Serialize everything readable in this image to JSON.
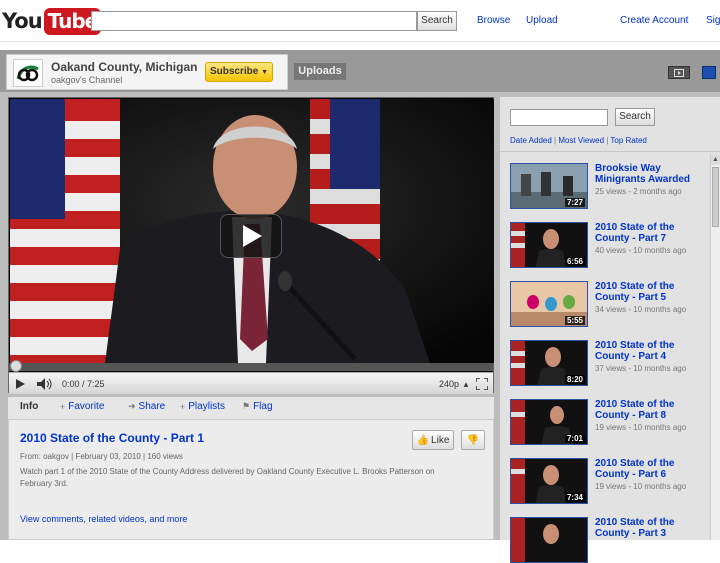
{
  "masthead": {
    "logo_you": "You",
    "logo_tube": "Tube",
    "search_placeholder": "",
    "search_button": "Search",
    "links": [
      "Browse",
      "Upload",
      "Create Account",
      "Sig"
    ]
  },
  "channel": {
    "name": "Oakand County, Michigan",
    "subtitle": "oakgov's Channel",
    "subscribe": "Subscribe",
    "uploads_tab": "Uploads"
  },
  "player": {
    "time": "0:00 / 7:25",
    "quality": "240p",
    "progress": 0.0
  },
  "info_tabs": {
    "info": "Info",
    "favorite": "Favorite",
    "share": "Share",
    "playlists": "Playlists",
    "flag": "Flag"
  },
  "video": {
    "title": "2010 State of the County - Part 1",
    "like": "Like",
    "meta": "From: oakgov | February 03, 2010 | 160 views",
    "description": "Watch part 1 of the 2010 State of the County Address delivered by Oakland County Executive L. Brooks Patterson on February 3rd.",
    "more": "View comments, related videos, and more"
  },
  "sidebar": {
    "search_button": "Search",
    "sort": {
      "date": "Date Added",
      "viewed": "Most Viewed",
      "rated": "Top Rated"
    },
    "videos": [
      {
        "title": "Brooksie Way Minigrants Awarded",
        "meta": "25 views - 2 months ago",
        "duration": "7:27"
      },
      {
        "title": "2010 State of the County - Part 7",
        "meta": "40 views - 10 months ago",
        "duration": "6:56"
      },
      {
        "title": "2010 State of the County - Part 5",
        "meta": "34 views - 10 months ago",
        "duration": "5:55"
      },
      {
        "title": "2010 State of the County - Part 4",
        "meta": "37 views - 10 months ago",
        "duration": "8:20"
      },
      {
        "title": "2010 State of the County - Part 8",
        "meta": "19 views - 10 months ago",
        "duration": "7:01"
      },
      {
        "title": "2010 State of the County - Part 6",
        "meta": "19 views - 10 months ago",
        "duration": "7:34"
      },
      {
        "title": "2010 State of the County - Part 3",
        "meta": "",
        "duration": ""
      }
    ]
  },
  "colors": {
    "link": "#0033cc",
    "youtube_red": "#cc181e",
    "subscribe_yellow": "#f5c300"
  }
}
